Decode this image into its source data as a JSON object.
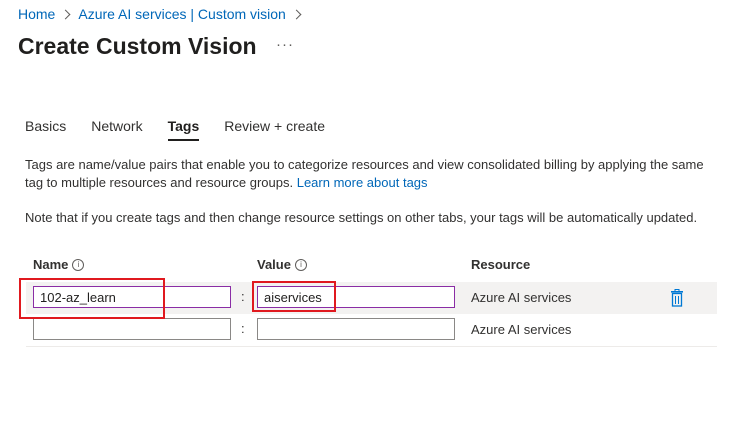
{
  "breadcrumb": {
    "home": "Home",
    "service": "Azure AI services | Custom vision"
  },
  "page": {
    "title": "Create Custom Vision",
    "more": "···"
  },
  "tabs": [
    {
      "label": "Basics"
    },
    {
      "label": "Network"
    },
    {
      "label": "Tags",
      "active": true
    },
    {
      "label": "Review + create"
    }
  ],
  "description": {
    "text": "Tags are name/value pairs that enable you to categorize resources and view consolidated billing by applying the same tag to multiple resources and resource groups.",
    "link": "Learn more about tags"
  },
  "note": "Note that if you create tags and then change resource settings on other tabs, your tags will be automatically updated.",
  "table": {
    "headers": {
      "name": "Name",
      "value": "Value",
      "resource": "Resource"
    },
    "separator": ":",
    "rows": [
      {
        "name": "102-az_learn",
        "value": "aiservices",
        "resource": "Azure AI services"
      },
      {
        "name": "",
        "value": "",
        "resource": "Azure AI services"
      }
    ]
  },
  "colors": {
    "accent": "#0067b8",
    "highlight": "#e0191f",
    "focus_border": "#8a2da5",
    "delete_icon": "#0078d4"
  }
}
